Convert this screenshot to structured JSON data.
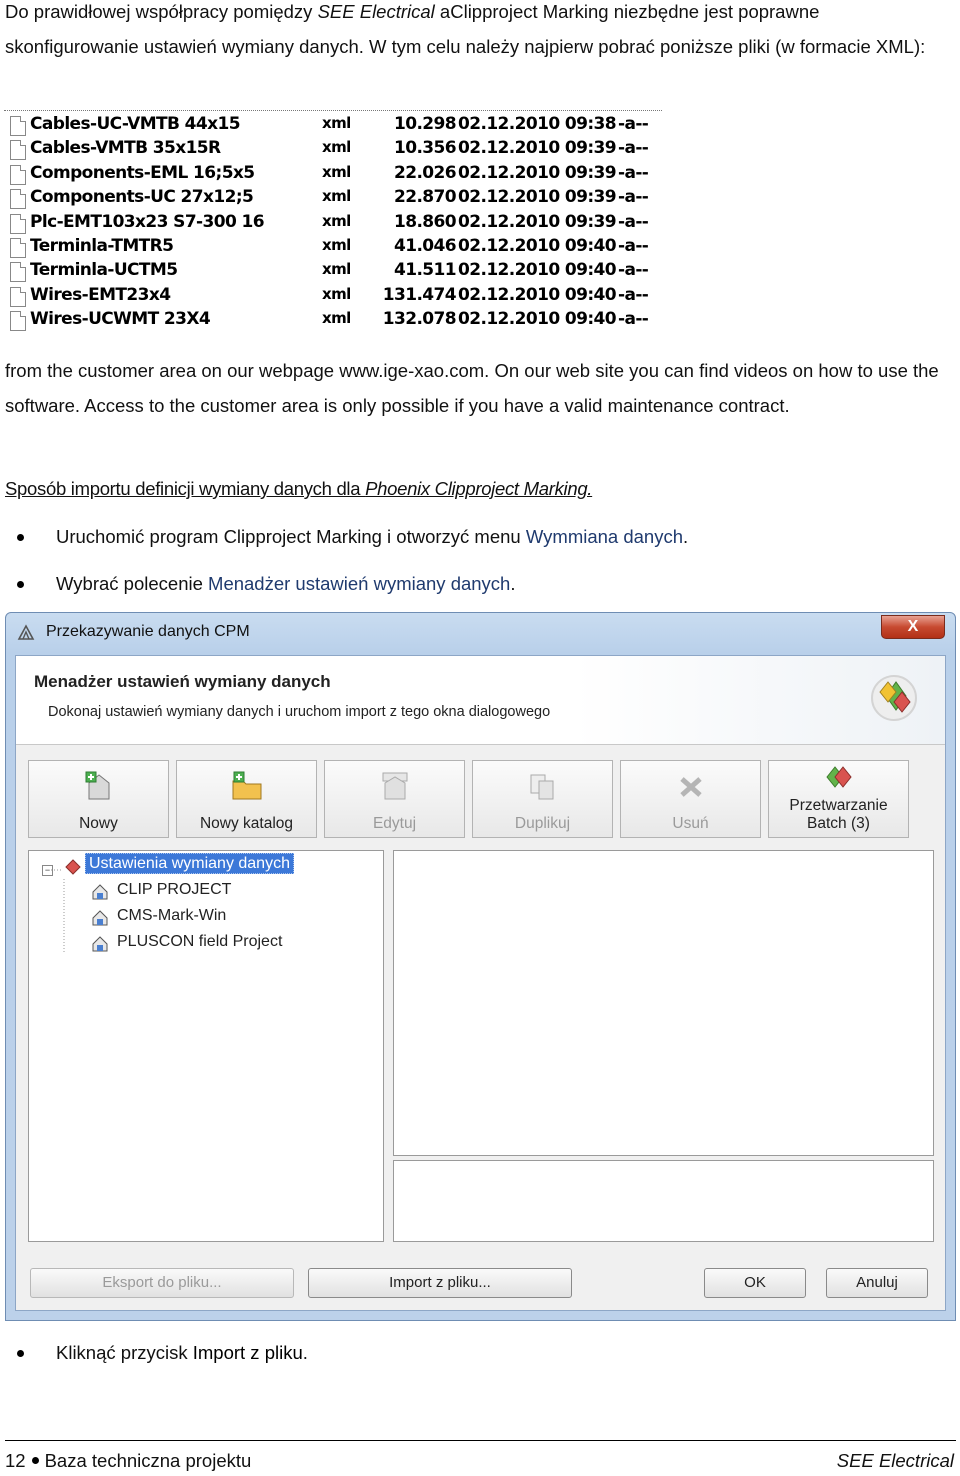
{
  "intro": {
    "p1": "Do prawidłowej współpracy pomiędzy ",
    "p1_brand": "SEE Electrical",
    "p1_rest": "  aClipproject Marking niezbędne jest poprawne skonfigurowanie ustawień wymiany danych. W tym celu należy najpierw pobrać poniższe pliki (w formacie XML):"
  },
  "files": [
    {
      "name": "Cables-UC-VMTB 44x15",
      "ext": "xml",
      "size": "10.298",
      "date": "02.12.2010 09:38",
      "attr": "-a--"
    },
    {
      "name": "Cables-VMTB 35x15R",
      "ext": "xml",
      "size": "10.356",
      "date": "02.12.2010 09:39",
      "attr": "-a--"
    },
    {
      "name": "Components-EML 16;5x5",
      "ext": "xml",
      "size": "22.026",
      "date": "02.12.2010 09:39",
      "attr": "-a--"
    },
    {
      "name": "Components-UC 27x12;5",
      "ext": "xml",
      "size": "22.870",
      "date": "02.12.2010 09:39",
      "attr": "-a--"
    },
    {
      "name": "Plc-EMT103x23 S7-300 16",
      "ext": "xml",
      "size": "18.860",
      "date": "02.12.2010 09:39",
      "attr": "-a--"
    },
    {
      "name": "Terminla-TMTR5",
      "ext": "xml",
      "size": "41.046",
      "date": "02.12.2010 09:40",
      "attr": "-a--"
    },
    {
      "name": "Terminla-UCTM5",
      "ext": "xml",
      "size": "41.511",
      "date": "02.12.2010 09:40",
      "attr": "-a--"
    },
    {
      "name": "Wires-EMT23x4",
      "ext": "xml",
      "size": "131.474",
      "date": "02.12.2010 09:40",
      "attr": "-a--"
    },
    {
      "name": "Wires-UCWMT 23X4",
      "ext": "xml",
      "size": "132.078",
      "date": "02.12.2010 09:40",
      "attr": "-a--"
    }
  ],
  "para2": "from the customer area on our webpage www.ige-xao.com. On our web site you can find videos on how to use the software. Access to the customer area is only possible if you have a valid maintenance contract.",
  "heading": {
    "text": "Sposób importu definicji wymiany danych dla ",
    "italic": "Phoenix Clipproject Marking."
  },
  "bullets": {
    "b1_text": "Uruchomić program Clipproject Marking i otworzyć menu ",
    "b1_link": "Wymmiana danych",
    "b1_end": ".",
    "b2_text": "Wybrać polecenie ",
    "b2_link": "Menadżer ustawień wymiany danych",
    "b2_end": ".",
    "b3_text": "Kliknąć przycisk ",
    "b3_bold": "Import z pliku",
    "b3_end": "."
  },
  "dialog": {
    "title": "Przekazywanie danych CPM",
    "close_label": "X",
    "header_title": "Menadżer ustawień wymiany danych",
    "header_subtitle": "Dokonaj ustawień wymiany danych i uruchom import z tego okna dialogowego",
    "toolbar": {
      "new_label": "Nowy",
      "new_catalog_label": "Nowy katalog",
      "edit_label": "Edytuj",
      "duplicate_label": "Duplikuj",
      "delete_label": "Usuń",
      "batch_line1": "Przetwarzanie",
      "batch_line2": "Batch (3)"
    },
    "tree": {
      "expander": "−",
      "root": "Ustawienia wymiany danych",
      "children": [
        "CLIP PROJECT",
        "CMS-Mark-Win",
        "PLUSCON field Project"
      ]
    },
    "buttons": {
      "export": "Eksport do pliku...",
      "import": "Import z pliku...",
      "ok": "OK",
      "cancel": "Anuluj"
    }
  },
  "footer": {
    "page_number": "12",
    "section": "Baza techniczna projektu",
    "brand": "SEE Electrical"
  },
  "colors": {
    "link_blue": "#1f3a6e",
    "selection": "#3c78d8",
    "close_red": "#c74a31"
  }
}
